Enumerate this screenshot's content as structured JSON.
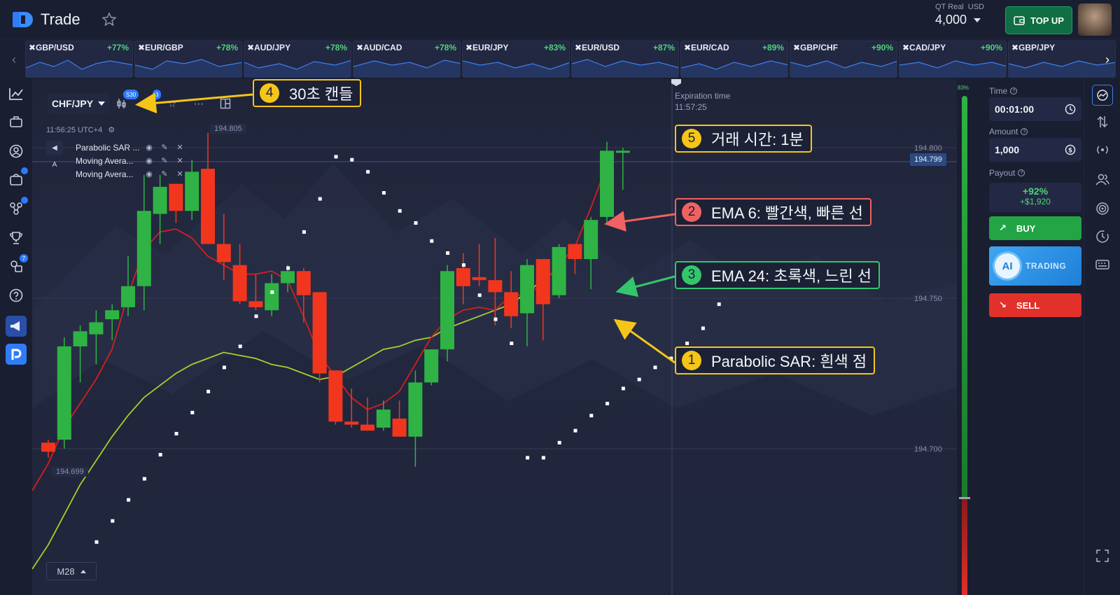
{
  "header": {
    "brand": "Trade",
    "account_type": "QT Real",
    "currency": "USD",
    "balance": "4,000",
    "topup_label": "TOP UP"
  },
  "tickers": [
    {
      "pair": "GBP/USD",
      "payout": "+77%"
    },
    {
      "pair": "EUR/GBP",
      "payout": "+78%"
    },
    {
      "pair": "AUD/JPY",
      "payout": "+78%"
    },
    {
      "pair": "AUD/CAD",
      "payout": "+78%"
    },
    {
      "pair": "EUR/JPY",
      "payout": "+83%"
    },
    {
      "pair": "EUR/USD",
      "payout": "+87%"
    },
    {
      "pair": "EUR/CAD",
      "payout": "+89%"
    },
    {
      "pair": "GBP/CHF",
      "payout": "+90%"
    },
    {
      "pair": "CAD/JPY",
      "payout": "+90%"
    },
    {
      "pair": "GBP/JPY",
      "payout": ""
    }
  ],
  "leftnav": {
    "badges": [
      "",
      "",
      "",
      "",
      "",
      "7"
    ]
  },
  "chart": {
    "pair": "CHF/JPY",
    "candle_badge": "S30",
    "indicator_badge": "3",
    "time": "11:56:25 UTC+4",
    "indicators": [
      "Parabolic SAR ...",
      "Moving Avera...",
      "Moving Avera..."
    ],
    "high_label": "194.805",
    "low_label": "194.699",
    "current_price": "194.799",
    "price_axis": [
      "194.800",
      "194.750",
      "194.700"
    ],
    "expiration_label": "Expiration time",
    "expiration_time": "11:57:25",
    "timeframe": "M28"
  },
  "annotations": {
    "a1_num": "1",
    "a1_text": "Parabolic SAR: 흰색 점",
    "a2_num": "2",
    "a2_text": "EMA 6: 빨간색, 빠른 선",
    "a3_num": "3",
    "a3_text": "EMA 24: 초록색, 느린 선",
    "a4_num": "4",
    "a4_text": "30초 캔들",
    "a5_num": "5",
    "a5_text": "거래 시간: 1분"
  },
  "sentiment": {
    "percent": "83%"
  },
  "trade_panel": {
    "time_label": "Time",
    "time_value": "00:01:00",
    "amount_label": "Amount",
    "amount_value": "1,000",
    "payout_label": "Payout",
    "payout_percent": "+92%",
    "payout_amount": "+$1,920",
    "buy_label": "BUY",
    "ai_label": "AI",
    "ai_trading_label": "TRADING",
    "sell_label": "SELL"
  },
  "colors": {
    "up_candle": "#2fb344",
    "down_candle": "#f2361e",
    "ema6": "#d41f1f",
    "ema24": "#a3d12a",
    "sar": "#ffffff",
    "annotation_yellow": "#f5c518",
    "annotation_red": "#f06262",
    "annotation_green": "#34c66b"
  },
  "candles": [
    {
      "o": 194.702,
      "h": 194.703,
      "l": 194.697,
      "c": 194.699
    },
    {
      "o": 194.703,
      "h": 194.737,
      "l": 194.7,
      "c": 194.734
    },
    {
      "o": 194.734,
      "h": 194.741,
      "l": 194.722,
      "c": 194.739
    },
    {
      "o": 194.738,
      "h": 194.746,
      "l": 194.728,
      "c": 194.742
    },
    {
      "o": 194.743,
      "h": 194.748,
      "l": 194.736,
      "c": 194.746
    },
    {
      "o": 194.747,
      "h": 194.764,
      "l": 194.744,
      "c": 194.754
    },
    {
      "o": 194.754,
      "h": 194.791,
      "l": 194.746,
      "c": 194.779
    },
    {
      "o": 194.778,
      "h": 194.791,
      "l": 194.768,
      "c": 194.787
    },
    {
      "o": 194.788,
      "h": 194.788,
      "l": 194.775,
      "c": 194.779
    },
    {
      "o": 194.779,
      "h": 194.796,
      "l": 194.776,
      "c": 194.792
    },
    {
      "o": 194.793,
      "h": 194.805,
      "l": 194.769,
      "c": 194.768
    },
    {
      "o": 194.768,
      "h": 194.778,
      "l": 194.756,
      "c": 194.762
    },
    {
      "o": 194.761,
      "h": 194.768,
      "l": 194.748,
      "c": 194.749
    },
    {
      "o": 194.749,
      "h": 194.758,
      "l": 194.746,
      "c": 194.747
    },
    {
      "o": 194.746,
      "h": 194.758,
      "l": 194.744,
      "c": 194.755
    },
    {
      "o": 194.755,
      "h": 194.761,
      "l": 194.752,
      "c": 194.759
    },
    {
      "o": 194.759,
      "h": 194.76,
      "l": 194.742,
      "c": 194.751
    },
    {
      "o": 194.752,
      "h": 194.752,
      "l": 194.722,
      "c": 194.725
    },
    {
      "o": 194.726,
      "h": 194.726,
      "l": 194.708,
      "c": 194.709
    },
    {
      "o": 194.709,
      "h": 194.72,
      "l": 194.707,
      "c": 194.708
    },
    {
      "o": 194.708,
      "h": 194.717,
      "l": 194.706,
      "c": 194.706
    },
    {
      "o": 194.707,
      "h": 194.716,
      "l": 194.706,
      "c": 194.713
    },
    {
      "o": 194.71,
      "h": 194.716,
      "l": 194.704,
      "c": 194.704
    },
    {
      "o": 194.704,
      "h": 194.726,
      "l": 194.694,
      "c": 194.722
    },
    {
      "o": 194.722,
      "h": 194.733,
      "l": 194.721,
      "c": 194.733
    },
    {
      "o": 194.733,
      "h": 194.761,
      "l": 194.729,
      "c": 194.759
    },
    {
      "o": 194.76,
      "h": 194.765,
      "l": 194.748,
      "c": 194.754
    },
    {
      "o": 194.757,
      "h": 194.768,
      "l": 194.754,
      "c": 194.756
    },
    {
      "o": 194.756,
      "h": 194.77,
      "l": 194.741,
      "c": 194.752
    },
    {
      "o": 194.752,
      "h": 194.759,
      "l": 194.74,
      "c": 194.744
    },
    {
      "o": 194.745,
      "h": 194.763,
      "l": 194.734,
      "c": 194.761
    },
    {
      "o": 194.763,
      "h": 194.763,
      "l": 194.736,
      "c": 194.748
    },
    {
      "o": 194.751,
      "h": 194.768,
      "l": 194.75,
      "c": 194.767
    },
    {
      "o": 194.768,
      "h": 194.768,
      "l": 194.758,
      "c": 194.763
    },
    {
      "o": 194.763,
      "h": 194.777,
      "l": 194.753,
      "c": 194.776
    },
    {
      "o": 194.777,
      "h": 194.802,
      "l": 194.775,
      "c": 194.799
    },
    {
      "o": 194.799,
      "h": 194.8,
      "l": 194.786,
      "c": 194.799
    }
  ],
  "ema6": [
    194.686,
    194.695,
    194.707,
    194.715,
    194.723,
    194.733,
    194.751,
    194.766,
    194.772,
    194.773,
    194.77,
    194.764,
    194.761,
    194.758,
    194.758,
    194.759,
    194.756,
    194.744,
    194.731,
    194.724,
    194.717,
    194.713,
    194.715,
    194.719,
    194.728,
    194.737,
    194.743,
    194.746,
    194.747,
    194.746,
    194.751,
    194.751,
    194.755,
    194.761,
    194.767,
    194.78,
    194.794
  ],
  "ema24": [
    194.66,
    194.668,
    194.678,
    194.688,
    194.696,
    194.704,
    194.711,
    194.717,
    194.721,
    194.725,
    194.728,
    194.73,
    194.732,
    194.731,
    194.73,
    194.728,
    194.727,
    194.725,
    194.723,
    194.724,
    194.727,
    194.73,
    194.733,
    194.734,
    194.736,
    194.737,
    194.74,
    194.742,
    194.744,
    194.746,
    194.748,
    194.752,
    194.756,
    194.76
  ],
  "sar": [
    194.669,
    194.676,
    194.683,
    194.69,
    194.698,
    194.705,
    194.712,
    194.719,
    194.727,
    194.734,
    194.744,
    194.752,
    194.76,
    194.772,
    194.783,
    194.797,
    194.796,
    194.792,
    194.785,
    194.779,
    194.775,
    194.769,
    194.765,
    194.761,
    194.751,
    194.743,
    194.735,
    194.697,
    194.697,
    194.702,
    194.706,
    194.711,
    194.715,
    194.72,
    194.723,
    194.727,
    194.73,
    194.735,
    194.74,
    194.748
  ]
}
